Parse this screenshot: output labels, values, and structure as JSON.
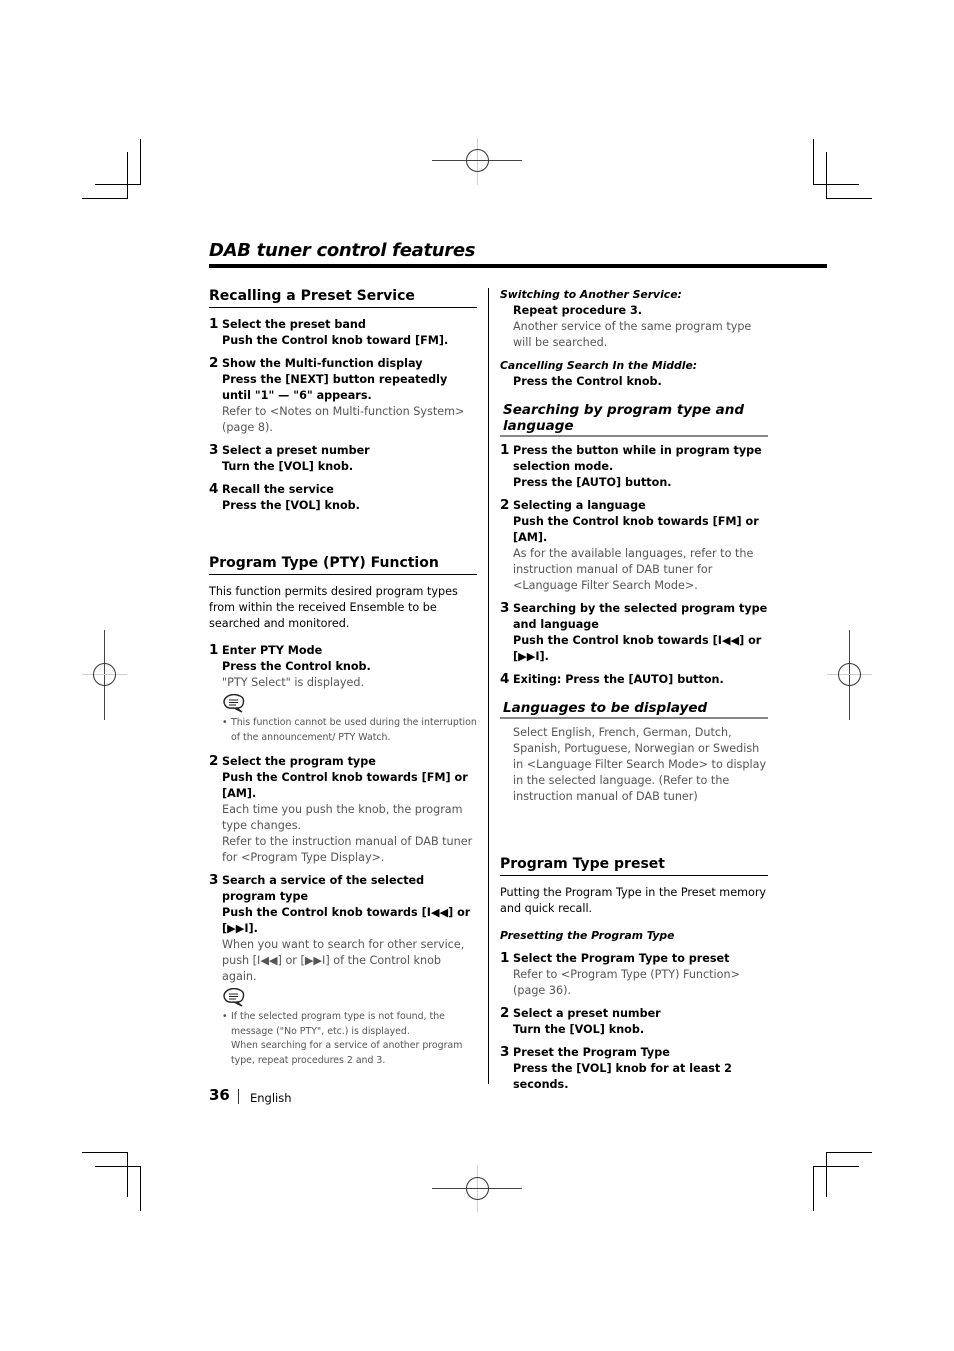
{
  "page": {
    "title": "DAB tuner control features",
    "page_number": "36",
    "language": "English"
  },
  "left": {
    "recall": {
      "heading": "Recalling a Preset Service",
      "steps": [
        {
          "num": "1",
          "title": "Select the preset band",
          "action": "Push the Control knob toward [FM].",
          "desc": ""
        },
        {
          "num": "2",
          "title": "Show the Multi-function display",
          "action": "Press the [NEXT] button repeatedly until \"1\" — \"6\" appears.",
          "desc": "Refer to <Notes on Multi-function System> (page 8)."
        },
        {
          "num": "3",
          "title": "Select a preset number",
          "action": "Turn the [VOL] knob.",
          "desc": ""
        },
        {
          "num": "4",
          "title": "Recall the service",
          "action": "Press the [VOL] knob.",
          "desc": ""
        }
      ]
    },
    "pty": {
      "heading": "Program Type (PTY) Function",
      "intro": "This function permits desired program types from within the received Ensemble to be searched and monitored.",
      "steps": [
        {
          "num": "1",
          "title": "Enter PTY Mode",
          "action": "Press the Control knob.",
          "desc": "\"PTY Select\" is displayed.",
          "note": "This function cannot be used during the interruption of the announcement/ PTY Watch."
        },
        {
          "num": "2",
          "title": "Select the program type",
          "action": "Push the Control knob towards [FM] or [AM].",
          "desc": "Each time you push the knob, the program type changes.",
          "desc2": "Refer to the instruction manual of DAB tuner for <Program Type Display>."
        },
        {
          "num": "3",
          "title": "Search a service of the selected program type",
          "action": "Push the Control knob towards [I◀◀] or [▶▶I].",
          "desc": "When you want to search for other service, push [I◀◀] or [▶▶I] of the Control knob again.",
          "note": "If the selected program type is not found, the message (\"No PTY\", etc.) is displayed.",
          "note2": "When searching for a service of another program type, repeat procedures 2 and 3."
        }
      ]
    }
  },
  "right": {
    "switching": {
      "label": "Switching to Another Service:",
      "action": "Repeat procedure 3.",
      "desc": "Another service of the same program type will be searched."
    },
    "cancelling": {
      "label": "Cancelling Search In the Middle:",
      "action": "Press the Control knob."
    },
    "search_lang": {
      "heading": "Searching by program type and language",
      "steps": [
        {
          "num": "1",
          "title": "Press the button while in program type selection mode.",
          "action": "Press the [AUTO] button.",
          "desc": ""
        },
        {
          "num": "2",
          "title": "Selecting a language",
          "action": "Push the Control knob towards [FM] or [AM].",
          "desc": "As for the available languages, refer to the instruction manual of DAB tuner for <Language Filter Search Mode>."
        },
        {
          "num": "3",
          "title": "Searching by the selected program type and language",
          "action": "Push the Control knob towards [I◀◀] or [▶▶I].",
          "desc": ""
        },
        {
          "num": "4",
          "title": "Exiting: Press the [AUTO] button.",
          "action": "",
          "desc": ""
        }
      ]
    },
    "languages": {
      "heading": "Languages to be displayed",
      "text": "Select English, French, German, Dutch, Spanish, Portuguese, Norwegian or Swedish in <Language Filter Search Mode> to display in the selected language. (Refer to the instruction manual of DAB tuner)"
    },
    "preset": {
      "heading": "Program Type preset",
      "intro": "Putting the Program Type in the Preset memory and quick recall.",
      "subheading": "Presetting the Program Type",
      "steps": [
        {
          "num": "1",
          "title": "Select the Program Type to preset",
          "action": "",
          "desc": "Refer to <Program Type (PTY) Function> (page 36)."
        },
        {
          "num": "2",
          "title": "Select a preset number",
          "action": "Turn the [VOL] knob.",
          "desc": ""
        },
        {
          "num": "3",
          "title": "Preset the Program Type",
          "action": "Press the [VOL] knob for at least 2 seconds.",
          "desc": ""
        }
      ]
    }
  },
  "icons": {
    "note": "note-speech-bubble-icon",
    "bullet": "•"
  }
}
